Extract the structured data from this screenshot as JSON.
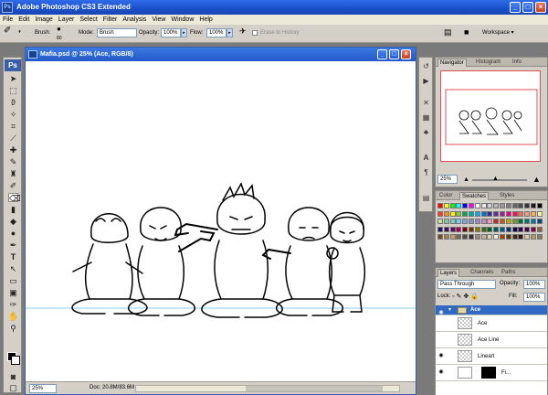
{
  "window": {
    "title": "Adobe Photoshop CS3 Extended",
    "ps_badge": "Ps"
  },
  "menu": [
    "File",
    "Edit",
    "Image",
    "Layer",
    "Select",
    "Filter",
    "Analysis",
    "View",
    "Window",
    "Help"
  ],
  "options": {
    "brush_label": "Brush:",
    "brush_size": "80",
    "mode_label": "Mode:",
    "mode_value": "Brush",
    "opacity_label": "Opacity:",
    "opacity_value": "100%",
    "flow_label": "Flow:",
    "flow_value": "100%",
    "erase_history": "Erase to History",
    "workspace": "Workspace ▾"
  },
  "document": {
    "title": "Mafia.psd @ 25% (Ace, RGB/8)",
    "zoom": "25%",
    "doc_info": "Doc: 20.8M/83.6M"
  },
  "navigator": {
    "tabs": [
      "Navigator",
      "Histogram",
      "Info"
    ],
    "zoom": "25%"
  },
  "swatches": {
    "tabs": [
      "Color",
      "Swatches",
      "Styles"
    ],
    "colors": [
      "#ff0000",
      "#ffff00",
      "#00ff00",
      "#00ffff",
      "#0000ff",
      "#ff00ff",
      "#ffffff",
      "#e6e6e6",
      "#cccccc",
      "#b3b3b3",
      "#999999",
      "#808080",
      "#666666",
      "#4d4d4d",
      "#333333",
      "#1a1a1a",
      "#000000",
      "#ff3b2f",
      "#ff8c1a",
      "#fff200",
      "#8dc63f",
      "#00a651",
      "#00a99d",
      "#00aeef",
      "#0072bc",
      "#2e3192",
      "#662d91",
      "#92278f",
      "#ec008c",
      "#ed145b",
      "#f26c4f",
      "#f7977a",
      "#fbaf5d",
      "#fff799",
      "#c4df9b",
      "#82ca9c",
      "#7accc8",
      "#6dcff6",
      "#7ea7d8",
      "#8493ca",
      "#a187be",
      "#bc8dbf",
      "#f49ac2",
      "#c1272d",
      "#c9541d",
      "#c7a600",
      "#6e9a2d",
      "#007236",
      "#00746b",
      "#0076a3",
      "#004a80",
      "#1b1464",
      "#440e62",
      "#630460",
      "#9e005d",
      "#790000",
      "#7b2e00",
      "#827b00",
      "#406618",
      "#005e20",
      "#005952",
      "#005b7f",
      "#003471",
      "#0d004c",
      "#32004b",
      "#4b0049",
      "#7b0046",
      "#8c6239",
      "#754c24",
      "#a67c52",
      "#c69c6d",
      "#736357",
      "#534741",
      "#362f2d",
      "#998675",
      "#c7b299",
      "#e0d1b8",
      "#f5ecdc",
      "#a0410d",
      "#603913",
      "#3f2a14",
      "#2b1a0b",
      "#d9c7a7",
      "#b1976b",
      "#8c7b5d"
    ]
  },
  "layers": {
    "tabs": [
      "Layers",
      "Channels",
      "Paths"
    ],
    "blend": "Pass Through",
    "opacity_label": "Opacity:",
    "opacity": "100%",
    "lock_label": "Lock:",
    "fill_label": "Fill:",
    "fill": "100%",
    "group": "Ace",
    "items": [
      "Ace",
      "Ace Line",
      "Lineart",
      "Fi..."
    ]
  }
}
